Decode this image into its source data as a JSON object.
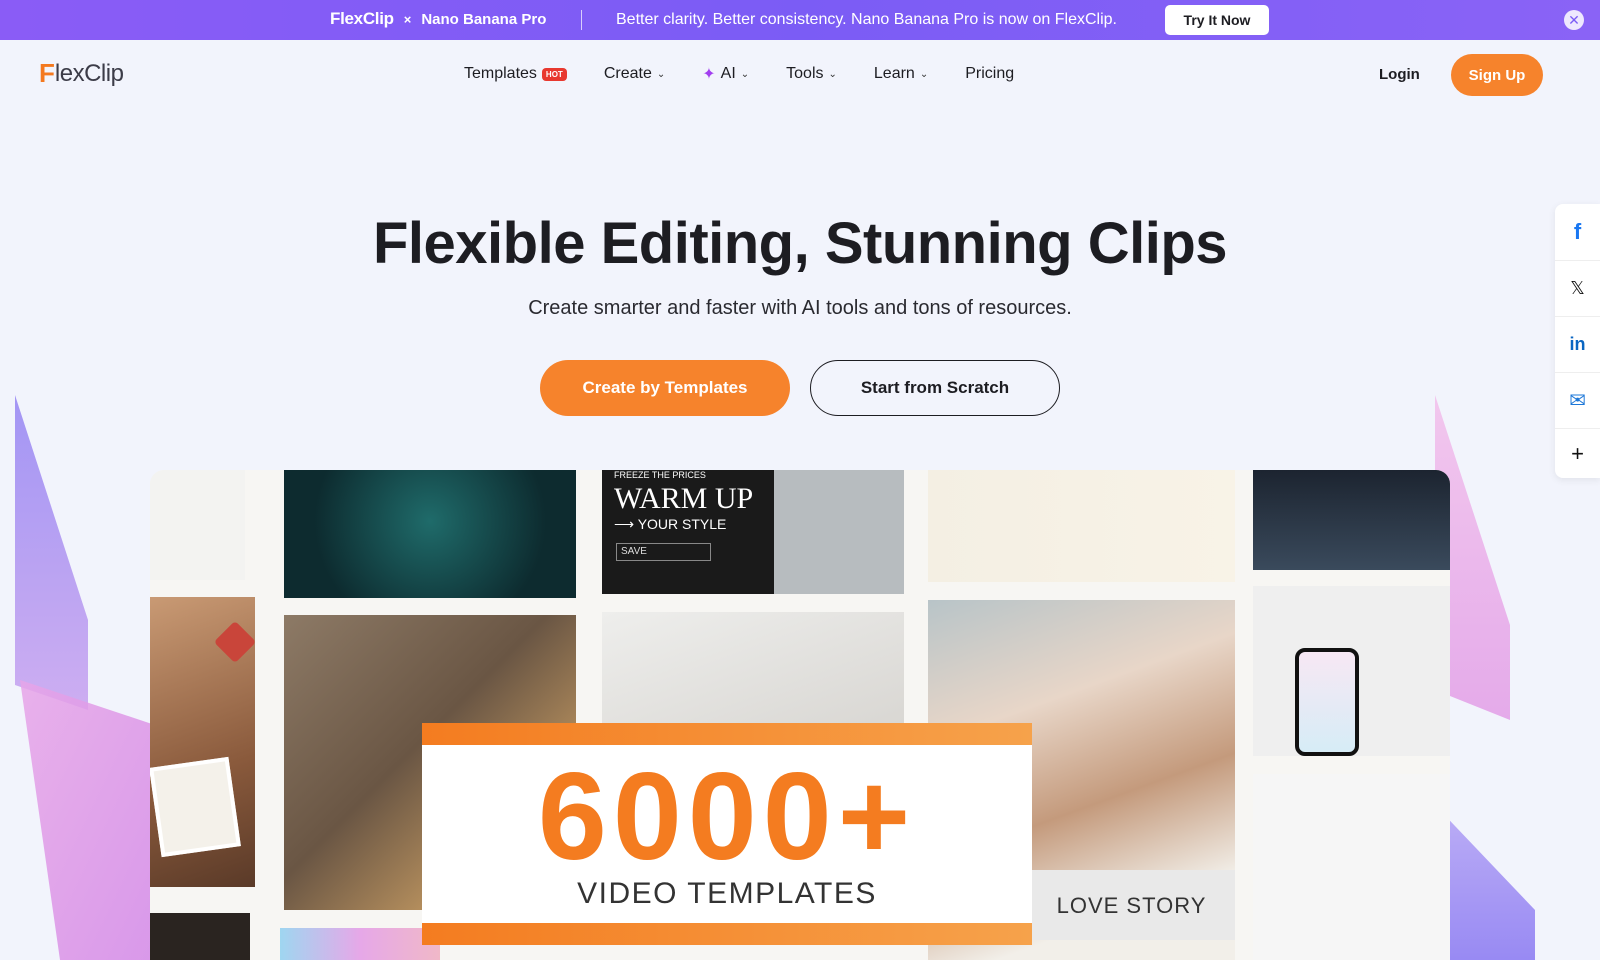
{
  "promo": {
    "brand": "FlexClip",
    "times": "×",
    "partner": "Nano Banana Pro",
    "message": "Better clarity. Better consistency. Nano Banana Pro is now on FlexClip.",
    "cta": "Try It Now",
    "close_icon": "✕"
  },
  "logo": {
    "first": "F",
    "rest": "lexClip"
  },
  "nav": {
    "templates": "Templates",
    "hot_badge": "HOT",
    "create": "Create",
    "ai": "AI",
    "tools": "Tools",
    "learn": "Learn",
    "pricing": "Pricing",
    "chevron": "⌄",
    "sparkle": "✦"
  },
  "auth": {
    "login": "Login",
    "signup": "Sign Up"
  },
  "hero": {
    "title": "Flexible Editing, Stunning Clips",
    "subtitle": "Create smarter and faster with AI tools and tons of resources.",
    "primary_cta": "Create by Templates",
    "secondary_cta": "Start from Scratch"
  },
  "collage": {
    "banner_number": "6000+",
    "banner_label": "VIDEO TEMPLATES",
    "warm_kicker": "FREEZE THE PRICES",
    "warm_title": "WARM UP",
    "warm_sub": "⟶ YOUR STYLE",
    "warm_save": "SAVE",
    "love_story": "LOVE STORY"
  },
  "social": {
    "facebook": "f",
    "x": "𝕏",
    "linkedin": "in",
    "email": "✉",
    "more": "+"
  },
  "colors": {
    "accent": "#f6832c",
    "promo_bg": "#7b5cf5",
    "hot": "#e8382f"
  }
}
